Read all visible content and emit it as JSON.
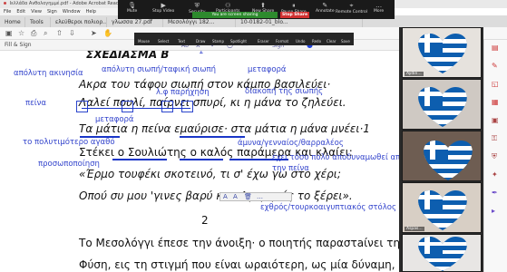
{
  "window": {
    "title": "Ιελλάδα Ανθολογημμέ.pdf - Adobe Acrobat Reader DC"
  },
  "menu": [
    "File",
    "Edit",
    "View",
    "Sign",
    "Window",
    "Help"
  ],
  "tabs": [
    {
      "label": "Home"
    },
    {
      "label": "Tools"
    },
    {
      "label": "ελεύθεροι πολιορ..."
    },
    {
      "label": "γλωσσα 27.pdf"
    },
    {
      "label": "Μεσολόγγι 182..."
    },
    {
      "label": "10-0182-01_blo..."
    }
  ],
  "zoom": {
    "items": [
      {
        "label": "Mute",
        "icon": "microphone-icon"
      },
      {
        "label": "Stop Video",
        "icon": "camera-icon"
      },
      {
        "label": "Security",
        "icon": "shield-icon"
      },
      {
        "label": "Participants",
        "icon": "people-icon"
      },
      {
        "label": "New Share",
        "icon": "share-icon"
      },
      {
        "label": "Pause Share",
        "icon": "pause-icon"
      },
      {
        "label": "Annotate",
        "icon": "pen-icon"
      },
      {
        "label": "Remote Control",
        "icon": "mouse-icon"
      },
      {
        "label": "More",
        "icon": "more-icon"
      }
    ],
    "share_badge": "You are screen sharing",
    "stop_share": "Stop Share",
    "annotate_tools": [
      "Mouse",
      "Select",
      "Text",
      "Draw",
      "Stamp",
      "Spotlight",
      "Eraser",
      "Format",
      "Undo",
      "Redo",
      "Clear",
      "Save"
    ]
  },
  "fill_sign": {
    "label": "Fill & Sign",
    "tools": [
      "Ab",
      "x",
      "check-icon",
      "circle-icon",
      "line-icon",
      "dot-icon",
      "Sign"
    ]
  },
  "document": {
    "title": "ΣΧΕΔΙΑΣΜΑ Β",
    "lines": [
      "Ακρα του τάφου σιωπή στον κάμπο βασιλεύει·",
      "Λαλεί πουλί, παίρνει σπυρί, κι η μάνα το ζηλεύει.",
      "Τα μάτια η πείνα εμαύρισε· στα μάτια η μάνα μνέει·1",
      "Στέκει ο Σουλιώτης ο καλός παράμερα και κλαίει:",
      "«Έρμο τουφέκι σκοτεινό, τι σ' έχω γω στο χέρι;",
      "Οπού συ μου 'γινες βαρύ κι ο Αγαρηνός το ξέρει».",
      "2",
      "Το Μεσολόγγι έπεσε την άνοιξη· ο ποιητής παραστaίνει τη",
      "Φύση, εις τη στιγμή που είναι ωραιότερη, ως μία δύναμη, η"
    ],
    "annotations": [
      "1",
      "απόλυτη ακινησία",
      "απόλυτη σιωπή/ταφική σιωπή",
      "μεταφορά",
      "λ.φ παρήχηση",
      "διακοπή της σιωπής",
      "πείνα",
      "μεταφορά",
      "το πολυτιμότερο αγαθό",
      "άμυνα/γενναίος/θαρραλέος",
      "προσωποποίηση",
      "έχει τόσο πολύ αποδυναμωθεί από",
      "την πείνα",
      "εχθρός/τουρκοαιγυπτιακός στόλος"
    ]
  },
  "video": {
    "tiles": [
      {
        "name": "Aydin..."
      },
      {
        "name": ""
      },
      {
        "name": ""
      },
      {
        "name": "Aspas..."
      },
      {
        "name": ""
      }
    ]
  },
  "colors": {
    "annotation_blue": "#3344cc",
    "greek_blue": "#0d5eaf",
    "zoom_dark": "#1a1a1a",
    "share_green": "#2d8a2d",
    "stop_red": "#d03030"
  }
}
